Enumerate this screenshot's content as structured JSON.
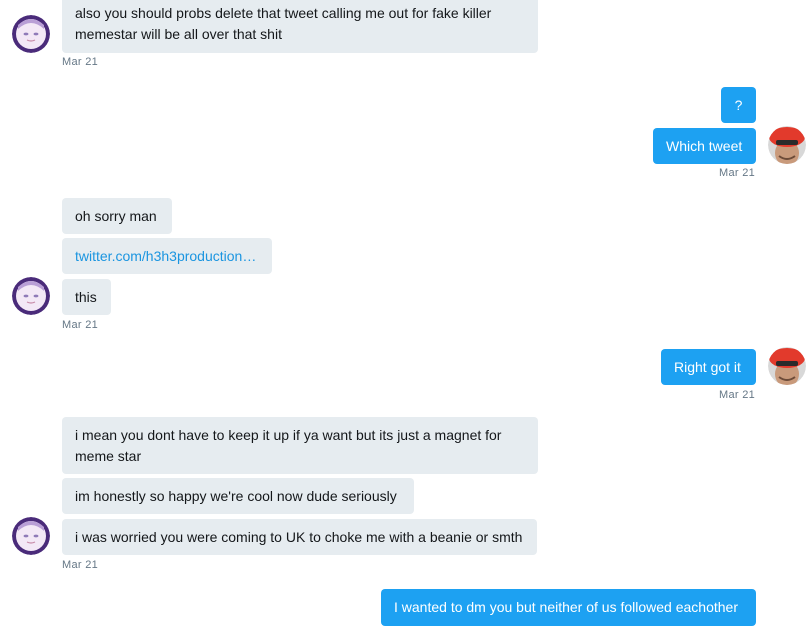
{
  "messages": {
    "m1": "also you should probs delete that tweet calling me out for fake killer memestar will be all over that shit",
    "m2": "?",
    "m3": "Which tweet",
    "m4": "oh sorry man",
    "m5": "twitter.com/h3h3production…",
    "m6": "this",
    "m7": "Right got it",
    "m8": "i mean you dont have to keep it up if ya want but its just a magnet for meme star",
    "m9": "im honestly so happy we're cool now dude seriously",
    "m10": "i was worried you were coming to UK to choke me with a beanie or smth",
    "m11": "I wanted to dm you but neither of us followed eachother"
  },
  "timestamps": {
    "t1": "Mar 21",
    "t2": "Mar 21",
    "t3": "Mar 21",
    "t4": "Mar 21",
    "t5": "Mar 21"
  },
  "avatars": {
    "other": "anime-girl-avatar-icon",
    "self": "red-beanie-man-avatar-icon"
  },
  "colors": {
    "incoming_bubble": "#e6ecf0",
    "outgoing_bubble": "#1da1f2",
    "link": "#1b95e0",
    "timestamp": "#657786"
  }
}
